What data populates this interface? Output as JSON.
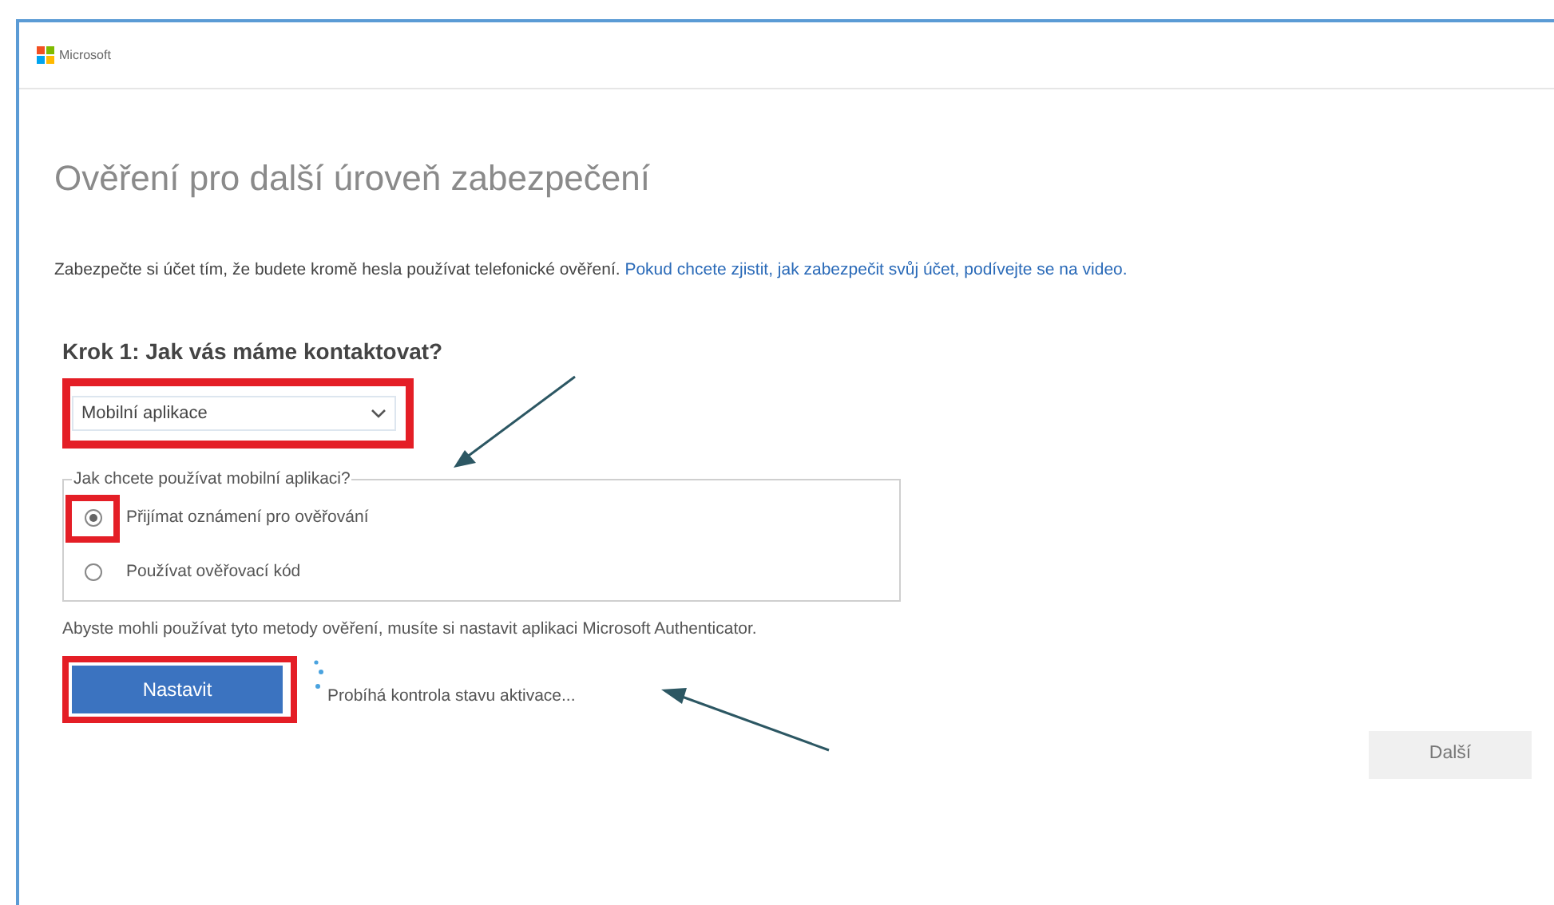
{
  "brand": {
    "name": "Microsoft"
  },
  "title": "Ověření pro další úroveň zabezpečení",
  "intro": {
    "text": "Zabezpečte si účet tím, že budete kromě hesla používat telefonické ověření.",
    "link": "Pokud chcete zjistit, jak zabezpečit svůj účet, podívejte se na video."
  },
  "step": {
    "heading": "Krok 1: Jak vás máme kontaktovat?",
    "select": {
      "value": "Mobilní aplikace",
      "highlighted": true
    }
  },
  "options": {
    "legend": "Jak chcete používat mobilní aplikaci?",
    "items": [
      {
        "label": "Přijímat oznámení pro ověřování",
        "selected": true,
        "highlighted": true
      },
      {
        "label": "Používat ověřovací kód",
        "selected": false,
        "highlighted": false
      }
    ]
  },
  "note": "Abyste mohli používat tyto metody ověření, musíte si nastavit aplikaci Microsoft Authenticator.",
  "setup_button": {
    "label": "Nastavit",
    "highlighted": true
  },
  "status": "Probíhá kontrola stavu aktivace...",
  "next_button": {
    "label": "Další",
    "disabled": true
  }
}
